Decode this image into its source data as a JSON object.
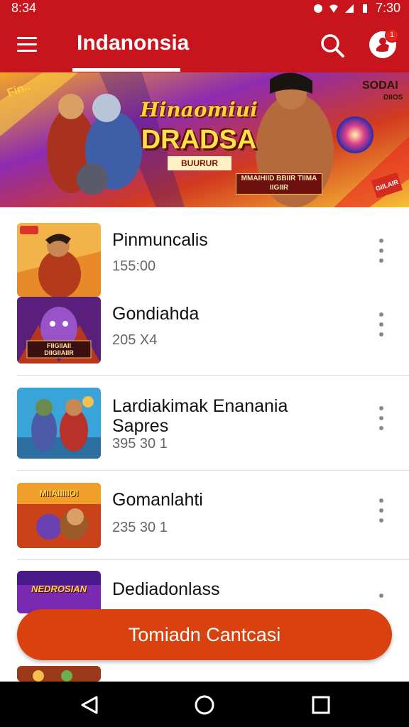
{
  "status_bar": {
    "time": "8:34",
    "clock": "7:30"
  },
  "app_bar": {
    "title": "Indanonsia",
    "notification_badge": "1"
  },
  "banner": {
    "title_line1": "Hinaomiui",
    "title_line2": "DRADSA",
    "subtitle": "BUURUR",
    "tag": "MMAIHIID BBIIR TIIMA IIGIIR",
    "corner_left": "Fin..",
    "corner_right": "SODAI",
    "corner_right_small": "DIIOS",
    "corner_badge": "GIILAIR"
  },
  "items": [
    {
      "name": "Pinmuncalis",
      "meta": "155:00",
      "thumb_text": ""
    },
    {
      "name": "Gondiahda",
      "meta": "205 X4",
      "thumb_text": "FIIGIIAII\nDIIGIIAIIR"
    },
    {
      "name": "Lardiakimak Enanania Sapres",
      "meta": "395 30 1",
      "thumb_text": ""
    },
    {
      "name": "Gomanlahti",
      "meta": "235 30 1",
      "thumb_text": "MIIAIIIIIOI"
    },
    {
      "name": "Dediadonlass",
      "meta": "",
      "thumb_text": "NEDROSIAN"
    }
  ],
  "cta": {
    "label": "Tomiadn Cantcasi"
  },
  "colors": {
    "brand_red": "#c8141c",
    "cta_orange": "#d9420f",
    "text_dark": "#111111",
    "text_muted": "#666666"
  },
  "icons": {
    "menu": "hamburger-icon",
    "search": "search-icon",
    "profile": "profile-icon",
    "back": "back-icon",
    "home": "home-icon",
    "recents": "recents-icon"
  }
}
